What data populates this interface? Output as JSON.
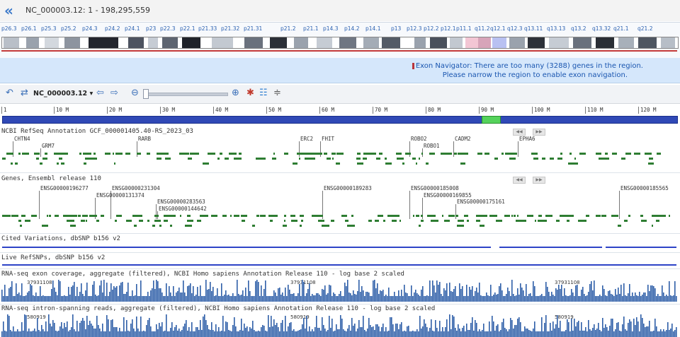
{
  "header": {
    "back_icon": "«",
    "title": "NC_000003.12:  1 - 198,295,559"
  },
  "ideogram": {
    "bands": [
      "p26.3",
      "p26.1",
      "p25.3",
      "p25.2",
      "p24.3",
      "p24.2",
      "p24.1",
      "p23",
      "p22.3",
      "p22.1",
      "p21.33",
      "p21.32",
      "p21.31",
      "p21.2",
      "p21.1",
      "p14.3",
      "p14.2",
      "p14.1",
      "p13",
      "p12.3",
      "p12.2",
      "p12.1",
      "p11.1",
      "q11.2",
      "q12.1",
      "q12.3",
      "q13.11",
      "q13.13",
      "q13.2",
      "q13.32",
      "q21.1",
      "q21.2"
    ]
  },
  "exon_navigator": {
    "line1": "Exon Navigator: There are too many (3288) genes in the region.",
    "line2": "Please narrow the region to enable exon navigation."
  },
  "toolbar": {
    "accession": "NC_000003.12",
    "dropdown": "▾"
  },
  "ruler": {
    "ticks": [
      "1",
      "10 M",
      "20 M",
      "30 M",
      "40 M",
      "50 M",
      "60 M",
      "70 M",
      "80 M",
      "90 M",
      "100 M",
      "110 M",
      "120 M"
    ]
  },
  "tracks": {
    "refseq": {
      "title": "NCBI RefSeq Annotation GCF_000001405.40-RS_2023_03",
      "genes": [
        "CHTN4",
        "GRM7",
        "RARB",
        "ERC2",
        "FHIT",
        "ROBO2",
        "ROBO1",
        "CADM2",
        "EPHA6"
      ]
    },
    "ensembl": {
      "title": "Genes, Ensembl release 110",
      "genes": [
        "ENSG00000196277",
        "ENSG00000231304",
        "ENSG00000131374",
        "ENSG00000283563",
        "ENSG00000144642",
        "ENSG00000189283",
        "ENSG00000185008",
        "ENSG00000169855",
        "ENSG00000175161",
        "ENSG00000185565"
      ]
    },
    "cited": {
      "title": "Cited Variations, dbSNP b156 v2"
    },
    "live": {
      "title": "Live RefSNPs, dbSNP b156 v2"
    },
    "rnaseq_cov": {
      "title": "RNA-seq exon coverage, aggregate (filtered), NCBI Homo sapiens Annotation Release 110 - log base 2 scaled",
      "max_values": [
        "37931108",
        "37931108",
        "37931108"
      ]
    },
    "rnaseq_intron": {
      "title": "RNA-seq intron-spanning reads, aggregate (filtered), NCBI Homo sapiens Annotation Release 110 - log base 2 scaled",
      "max_values": [
        "580919",
        "580919",
        "580919"
      ]
    }
  },
  "colors": {
    "feature": "#2e7d32",
    "variation": "#2d43c7",
    "coverage": "#2f5fa8",
    "accent": "#3a78c9"
  }
}
